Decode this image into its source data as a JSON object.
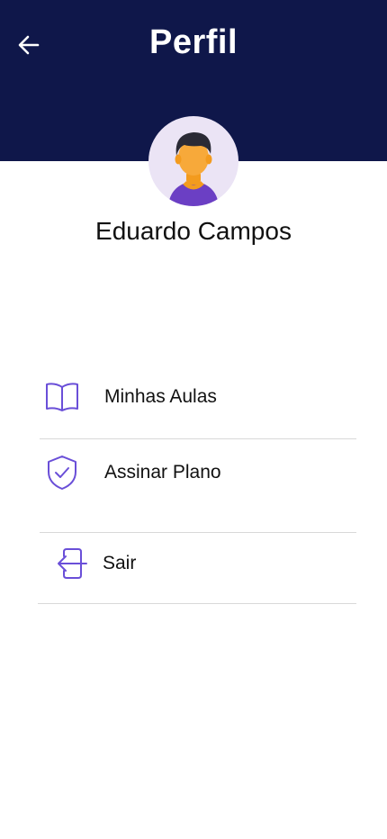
{
  "header": {
    "title": "Perfil",
    "back_icon": "arrow-left-icon",
    "background_color": "#0f174a"
  },
  "profile": {
    "name": "Eduardo Campos",
    "avatar_icon": "user-avatar-icon"
  },
  "menu": {
    "items": [
      {
        "label": "Minhas Aulas",
        "icon": "book-open-icon"
      },
      {
        "label": "Assinar Plano",
        "icon": "shield-check-icon"
      },
      {
        "label": "Sair",
        "icon": "logout-icon"
      }
    ],
    "icon_color": "#6a4fd8"
  }
}
